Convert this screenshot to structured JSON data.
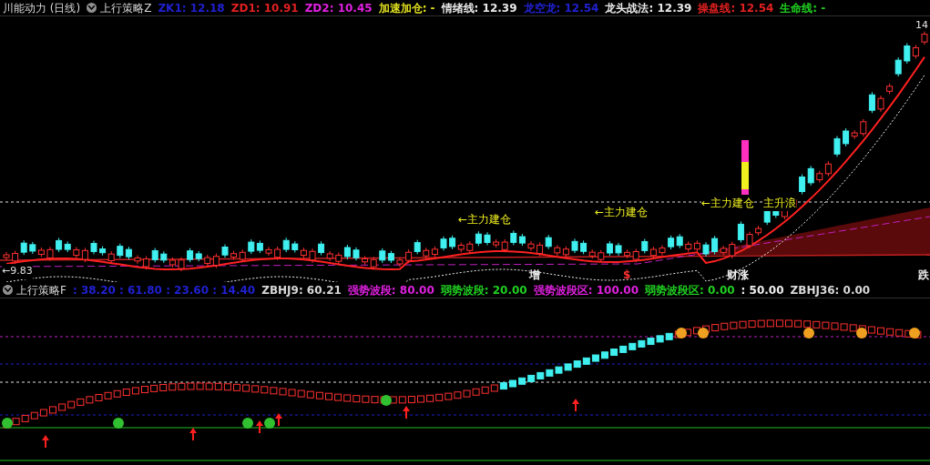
{
  "main_header": {
    "title": "川能动力 (日线)",
    "indicator": "上行策略Z",
    "items": [
      {
        "text": "ZK1: 12.18",
        "color": "#2020d0"
      },
      {
        "text": "ZD1: 10.91",
        "color": "#e02020"
      },
      {
        "text": "ZD2: 10.45",
        "color": "#e020e0"
      },
      {
        "text": "加速加仓: -",
        "color": "#e0e020"
      },
      {
        "text": "情绪线: 12.39",
        "color": "#e8e8e8"
      },
      {
        "text": "龙空龙: 12.54",
        "color": "#2020d0"
      },
      {
        "text": "龙头战法: 12.39",
        "color": "#e8e8e8"
      },
      {
        "text": "操盘线: 12.54",
        "color": "#e02020"
      },
      {
        "text": "生命线: -",
        "color": "#20d020"
      }
    ]
  },
  "main_chart": {
    "high_label": "14",
    "low_label": "←9.83",
    "annotations": [
      {
        "text": "←主力建仓"
      },
      {
        "text": "←主力建仓"
      },
      {
        "text": "←主力建仓"
      },
      {
        "text": "主升浪"
      }
    ],
    "signals": [
      {
        "text": "增",
        "color": "#f0f0f0"
      },
      {
        "text": "$",
        "color": "#ff3030"
      },
      {
        "text": "财涨",
        "color": "#f0f0f0"
      },
      {
        "text": "跌",
        "color": "#f0f0f0"
      }
    ]
  },
  "sub_header": {
    "indicator": "上行策略F",
    "items": [
      {
        "text": ": 38.20 : 61.80 : 23.60 : 14.40",
        "color": "#2020d0"
      },
      {
        "text": "ZBHJ9: 60.21",
        "color": "#d8d8d8"
      },
      {
        "text": "强势波段: 80.00",
        "color": "#e020e0"
      },
      {
        "text": "弱势波段: 20.00",
        "color": "#20d020"
      },
      {
        "text": "强势波段区: 100.00",
        "color": "#e020e0"
      },
      {
        "text": "弱势波段区: 0.00",
        "color": "#20d020"
      },
      {
        "text": ": 50.00",
        "color": "#f0f0f0"
      },
      {
        "text": "ZBHJ36: 0.00",
        "color": "#d8d8d8"
      }
    ]
  }
}
